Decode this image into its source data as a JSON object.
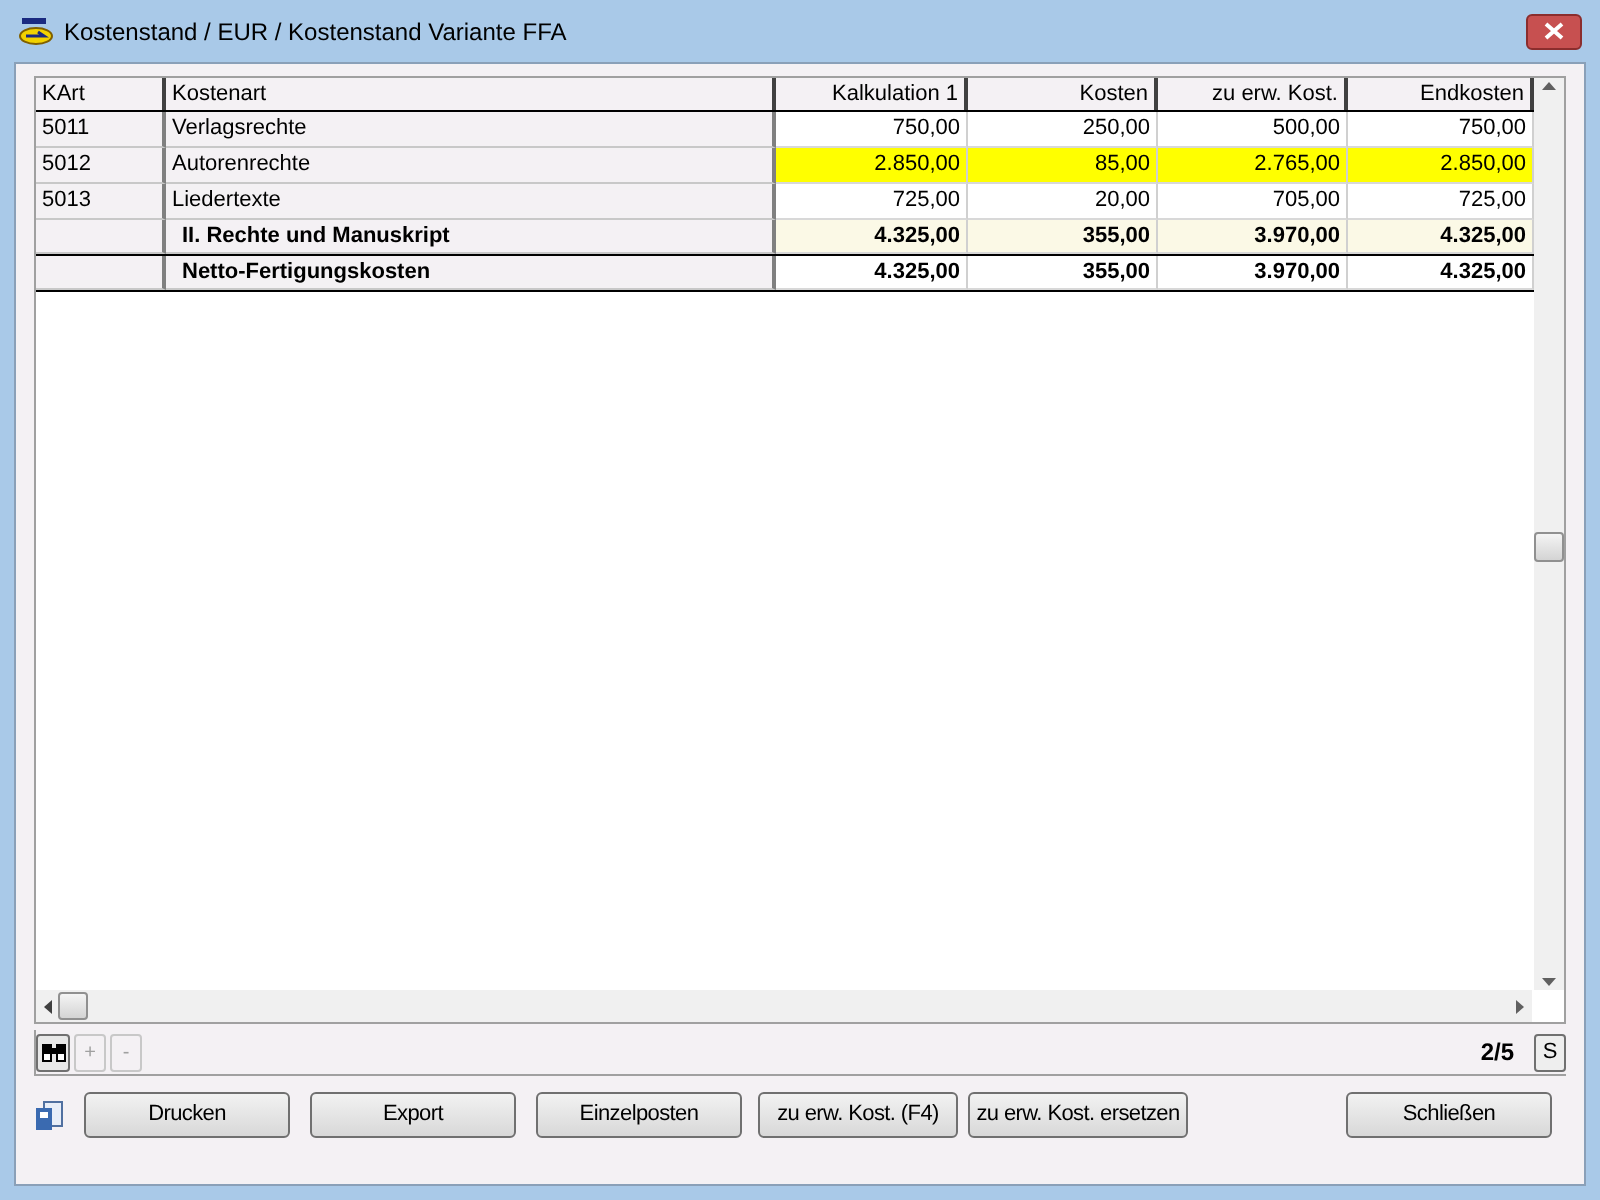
{
  "window": {
    "title": "Kostenstand / EUR / Kostenstand Variante FFA"
  },
  "table": {
    "columns": [
      "KArt",
      "Kostenart",
      "Kalkulation 1",
      "Kosten",
      "zu erw. Kost.",
      "Endkosten"
    ],
    "rows": [
      {
        "kind": "item",
        "cells": [
          "5011",
          "Verlagsrechte",
          "750,00",
          "250,00",
          "500,00",
          "750,00"
        ]
      },
      {
        "kind": "highlight",
        "cells": [
          "5012",
          "Autorenrechte",
          "2.850,00",
          "85,00",
          "2.765,00",
          "2.850,00"
        ]
      },
      {
        "kind": "item",
        "cells": [
          "5013",
          "Liedertexte",
          "725,00",
          "20,00",
          "705,00",
          "725,00"
        ]
      },
      {
        "kind": "subtotal",
        "cells": [
          "",
          "II. Rechte und Manuskript",
          "4.325,00",
          "355,00",
          "3.970,00",
          "4.325,00"
        ]
      },
      {
        "kind": "total",
        "cells": [
          "",
          "Netto-Fertigungskosten",
          "4.325,00",
          "355,00",
          "3.970,00",
          "4.325,00"
        ]
      }
    ]
  },
  "navigator": {
    "buttons": [
      {
        "label": "+",
        "disabled": true
      },
      {
        "label": "-",
        "disabled": true
      }
    ],
    "page": "2/5",
    "s_button": "S"
  },
  "buttons": [
    "Drucken",
    "Export",
    "Einzelposten",
    "zu erw. Kost. (F4)",
    "zu erw. Kost. ersetzen"
  ],
  "close_button": "Schließen"
}
